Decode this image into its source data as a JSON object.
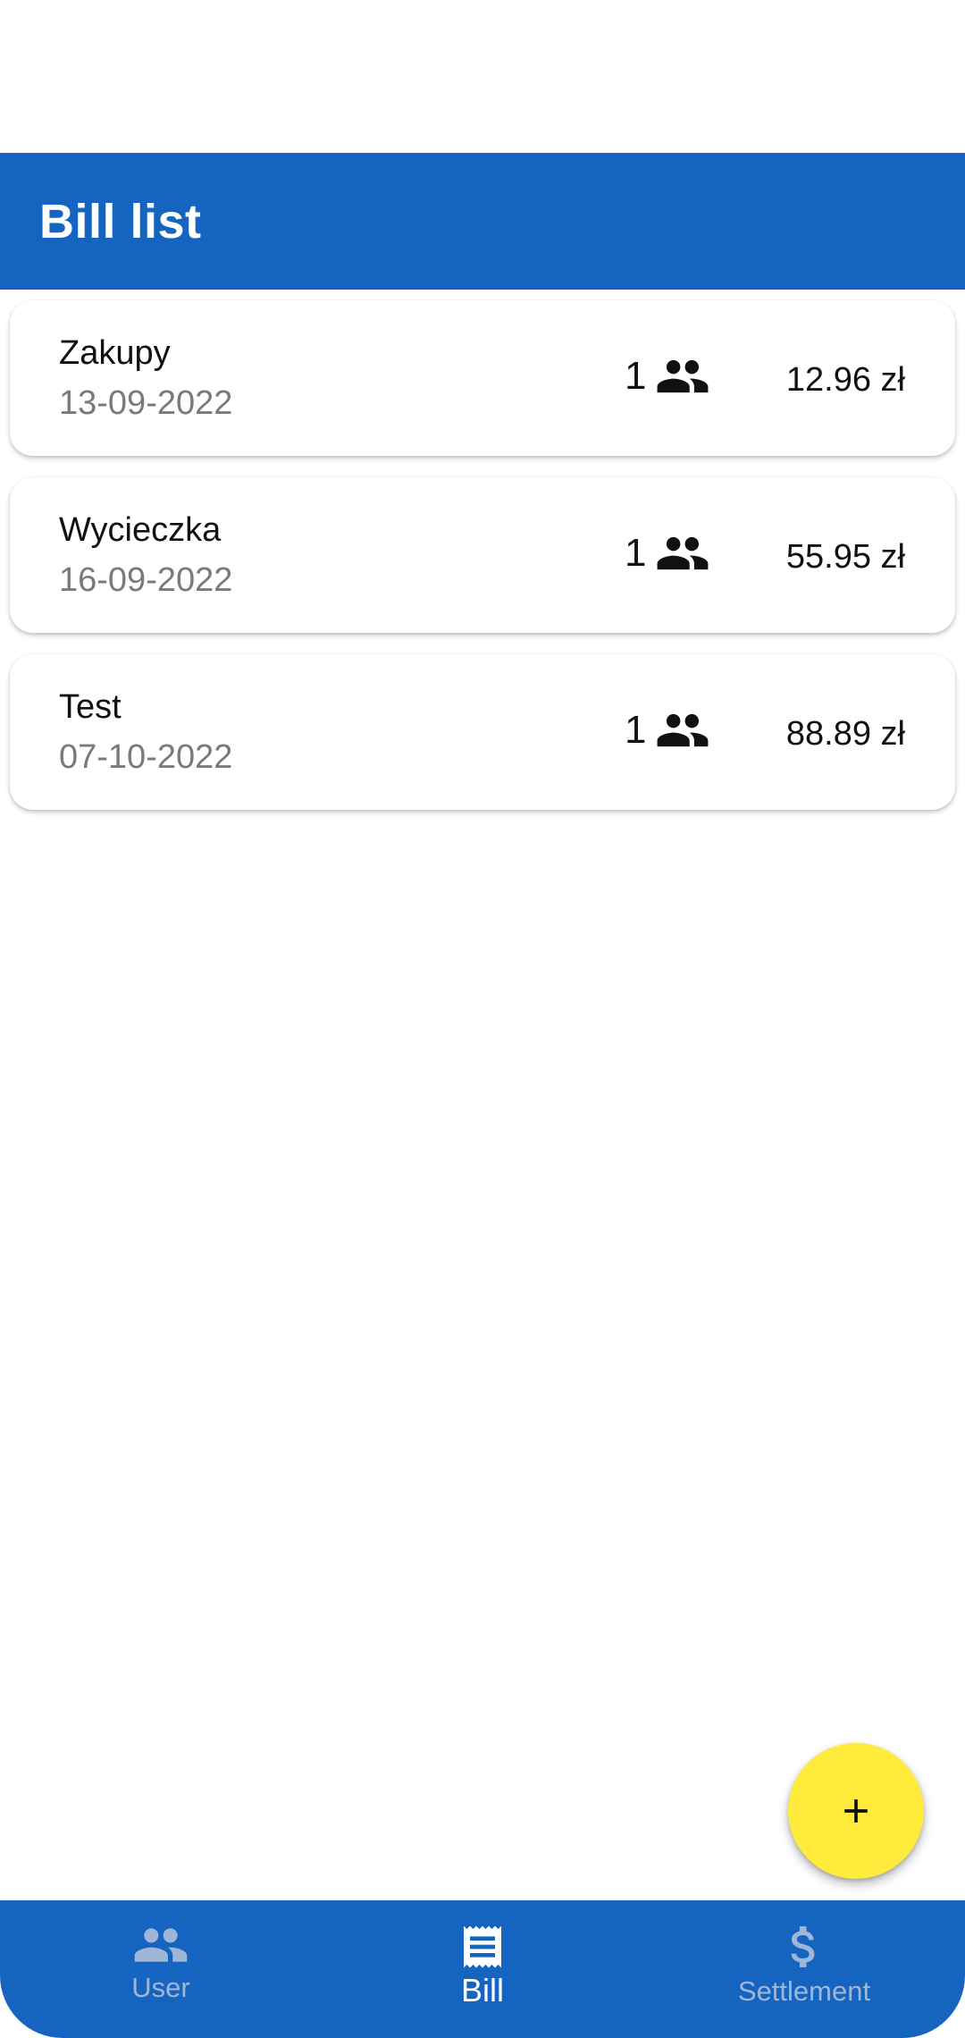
{
  "app_bar": {
    "title": "Bill list"
  },
  "bills": [
    {
      "name": "Zakupy",
      "date": "13-09-2022",
      "people": "1",
      "amount": "12.96 zł",
      "icon": "people-icon"
    },
    {
      "name": "Wycieczka",
      "date": "16-09-2022",
      "people": "1",
      "amount": "55.95 zł",
      "icon": "people-icon"
    },
    {
      "name": "Test",
      "date": "07-10-2022",
      "people": "1",
      "amount": "88.89 zł",
      "icon": "people-icon"
    }
  ],
  "fab": {
    "icon": "plus-icon",
    "color": "#ffeb3b"
  },
  "bottom_nav": {
    "items": [
      {
        "label": "User",
        "icon": "people-icon",
        "active": false
      },
      {
        "label": "Bill",
        "icon": "receipt-icon",
        "active": true
      },
      {
        "label": "Settlement",
        "icon": "dollar-icon",
        "active": false
      }
    ]
  },
  "colors": {
    "primary": "#1565c0",
    "accent": "#ffeb3b",
    "inactive_nav": "#9fb6d8",
    "secondary_text": "#7a7a7a"
  }
}
